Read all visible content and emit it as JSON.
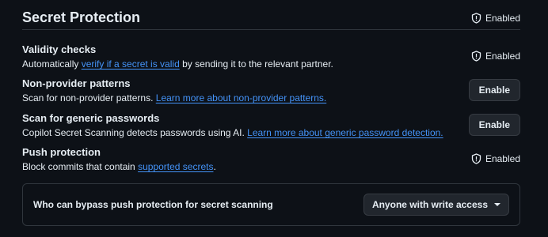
{
  "section": {
    "title": "Secret Protection",
    "status": "Enabled"
  },
  "validity": {
    "title": "Validity checks",
    "desc_before": "Automatically ",
    "link": "verify if a secret is valid",
    "desc_after": " by sending it to the relevant partner.",
    "status": "Enabled"
  },
  "non_provider": {
    "title": "Non-provider patterns",
    "desc_before": "Scan for non-provider patterns. ",
    "link": "Learn more about non-provider patterns.",
    "button": "Enable"
  },
  "generic_passwords": {
    "title": "Scan for generic passwords",
    "desc_before": "Copilot Secret Scanning detects passwords using AI. ",
    "link": "Learn more about generic password detection.",
    "button": "Enable"
  },
  "push_protection": {
    "title": "Push protection",
    "desc_before": "Block commits that contain ",
    "link": "supported secrets",
    "desc_after": ".",
    "status": "Enabled"
  },
  "bypass": {
    "label": "Who can bypass push protection for secret scanning",
    "selected": "Anyone with write access"
  },
  "colors": {
    "background": "#0d1117",
    "text": "#e6edf3",
    "link": "#4493f8",
    "border": "#30363d",
    "button_bg": "#21262d"
  },
  "icons": {
    "status": "shield-check-icon",
    "dropdown": "triangle-down-icon"
  }
}
